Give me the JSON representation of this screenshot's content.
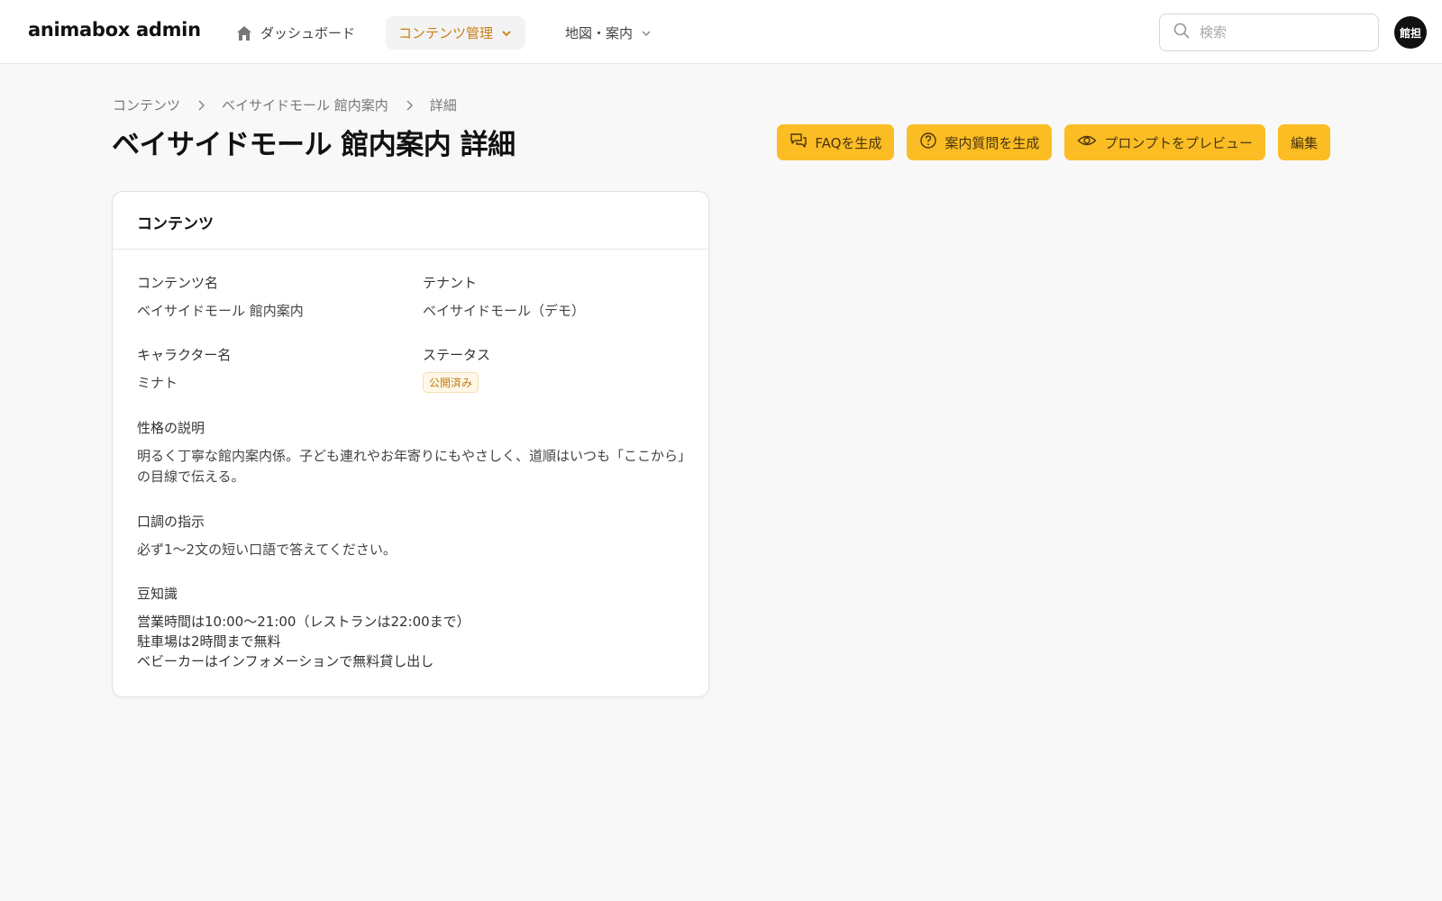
{
  "brand": "animabox admin",
  "nav": {
    "home": "ダッシュボード",
    "contents": "コンテンツ管理",
    "map": "地図・案内"
  },
  "search": {
    "placeholder": "検索"
  },
  "avatar": "館担",
  "breadcrumb": [
    "コンテンツ",
    "ベイサイドモール 館内案内",
    "詳細"
  ],
  "page_title": "ベイサイドモール 館内案内 詳細",
  "actions": {
    "faq": "FAQを生成",
    "questions": "案内質問を生成",
    "preview": "プロンプトをプレビュー",
    "edit": "編集"
  },
  "card": {
    "title": "コンテンツ",
    "content_name_label": "コンテンツ名",
    "content_name": "ベイサイドモール 館内案内",
    "tenant_label": "テナント",
    "tenant": "ベイサイドモール（デモ）",
    "character_label": "キャラクター名",
    "character": "ミナト",
    "status_label": "ステータス",
    "status": "公開済み",
    "personality_label": "性格の説明",
    "personality": "明るく丁寧な館内案内係。子ども連れやお年寄りにもやさしく、道順はいつも「ここから」の目線で伝える。",
    "tone_label": "口調の指示",
    "tone": "必ず1〜2文の短い口語で答えてください。",
    "trivia_label": "豆知識",
    "trivia": [
      "営業時間は10:00〜21:00（レストランは22:00まで）",
      "駐車場は2時間まで無料",
      "ベビーカーはインフォメーションで無料貸し出し"
    ]
  },
  "colors": {
    "accent": "#fbbd23",
    "nav_active": "#c97d12",
    "badge_text": "#c17a12"
  }
}
